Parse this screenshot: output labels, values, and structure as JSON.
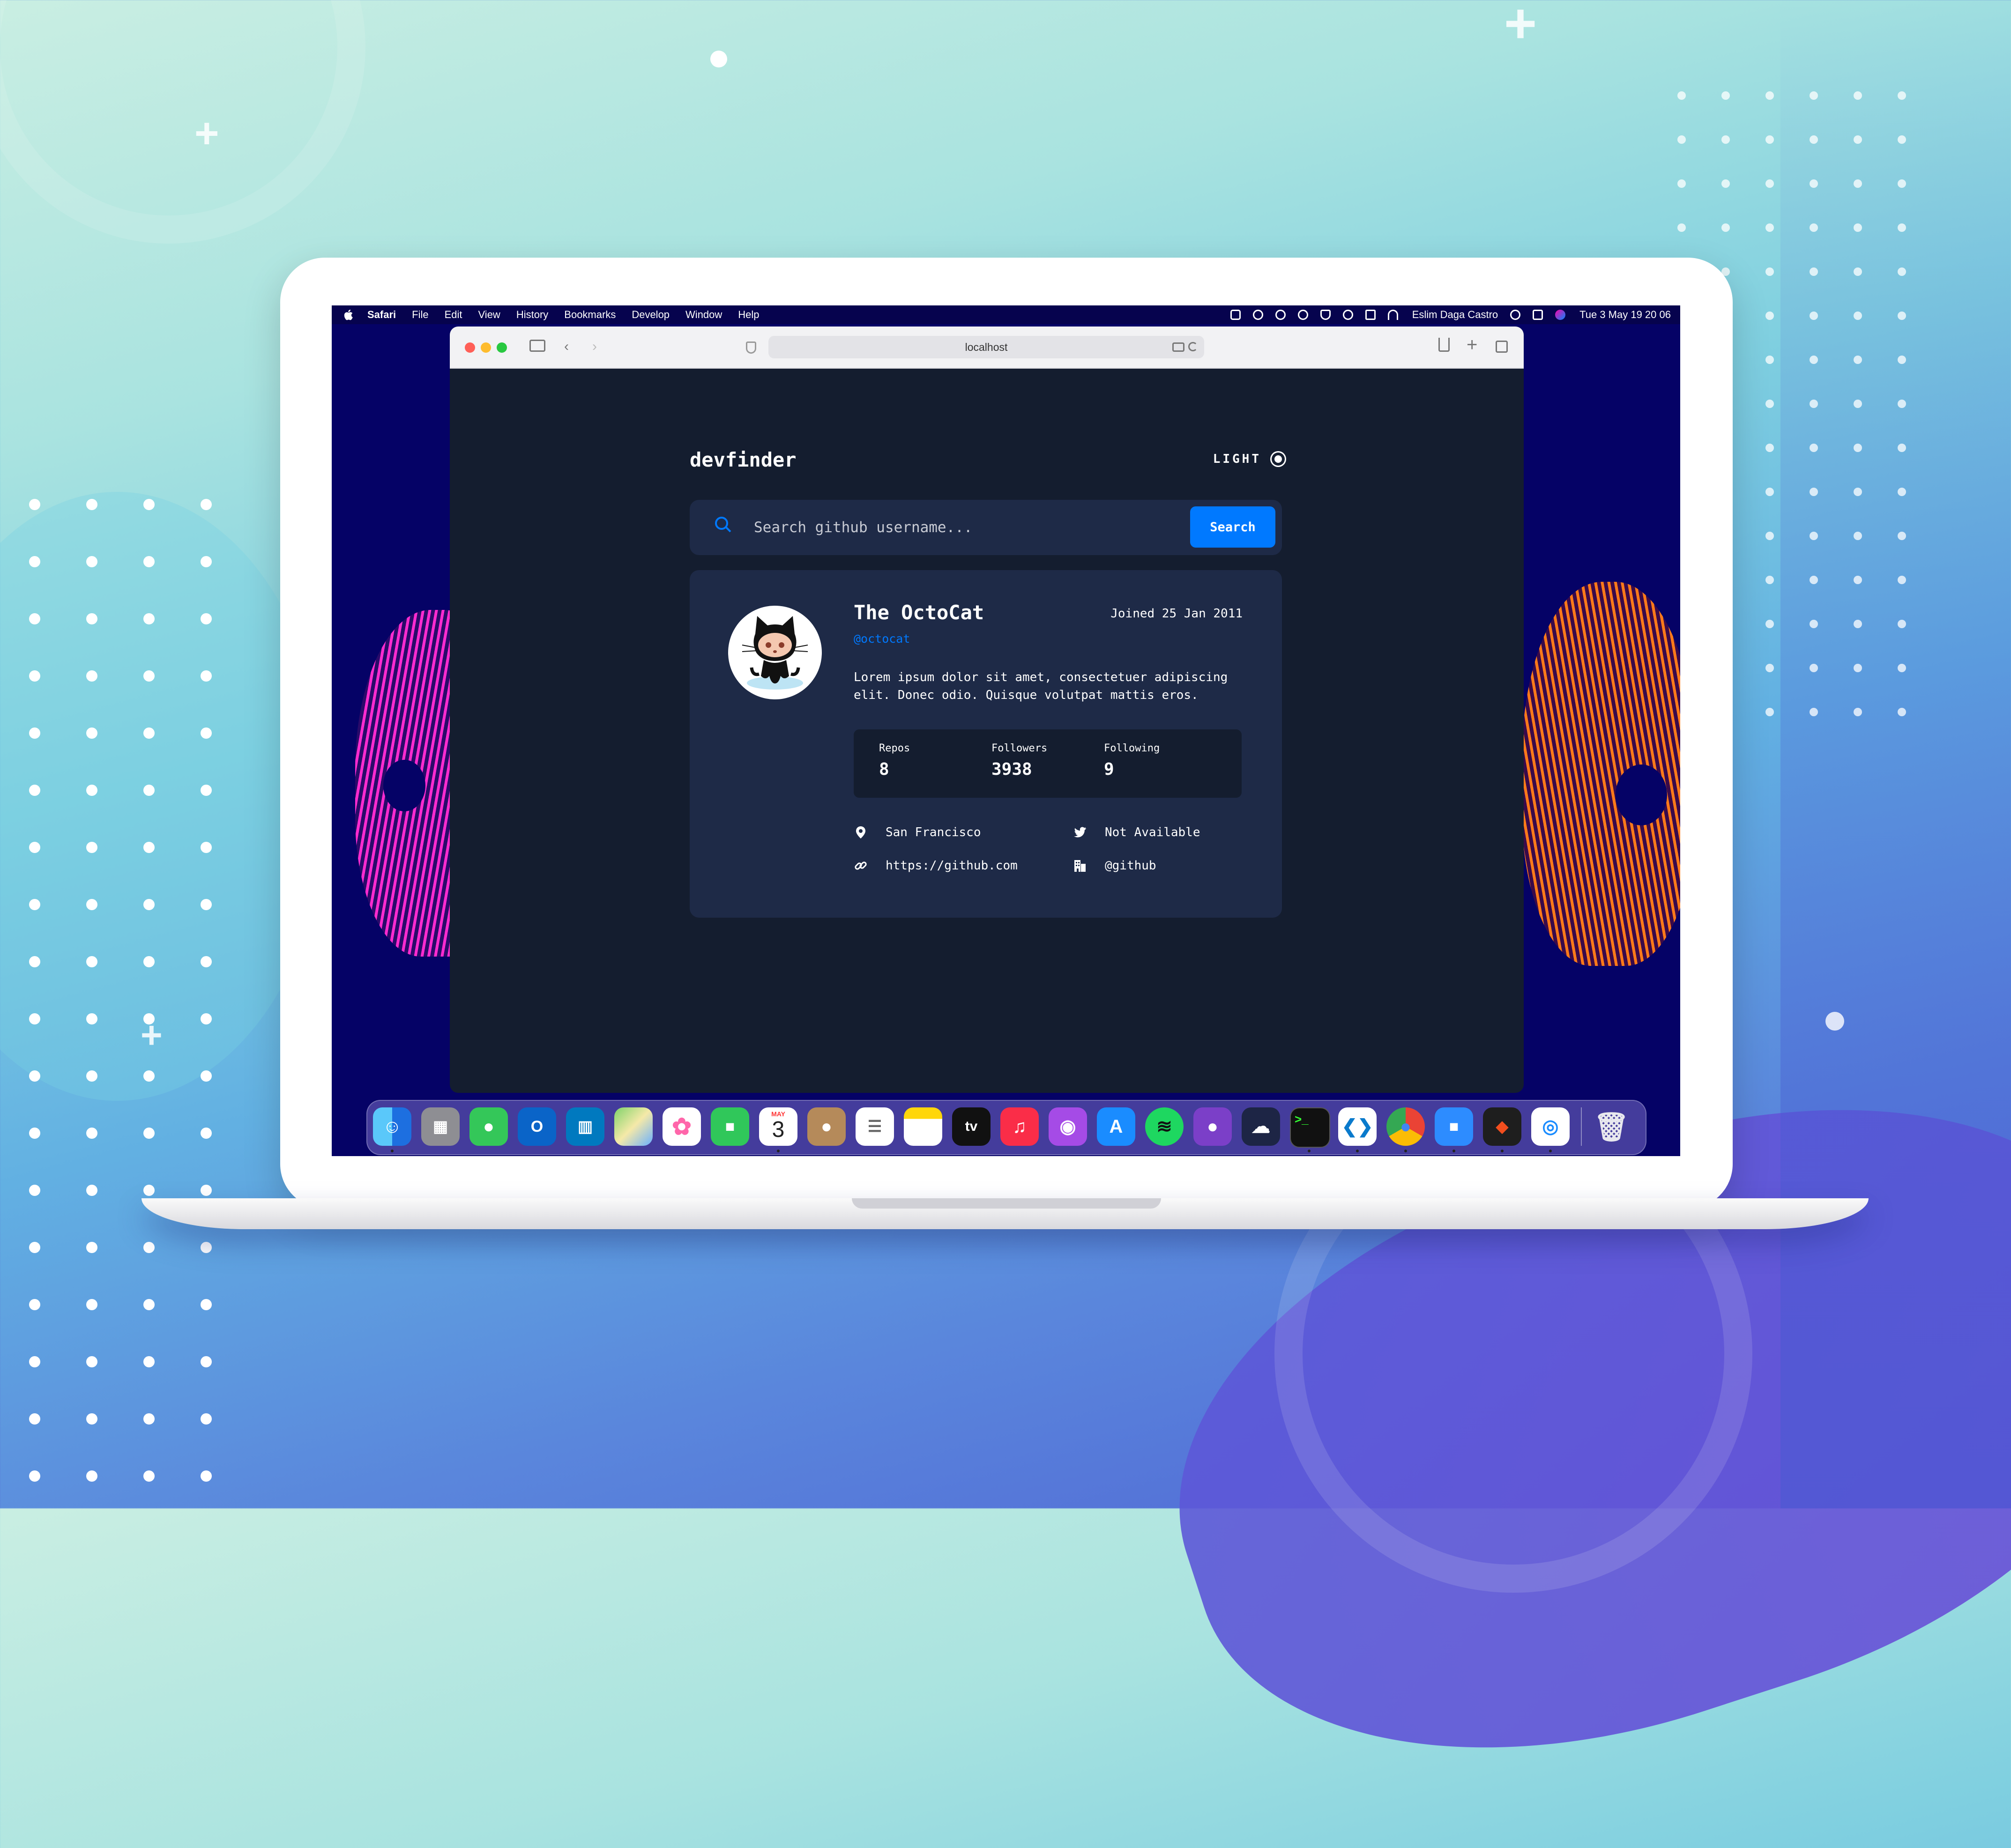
{
  "menubar": {
    "app": "Safari",
    "items": [
      "File",
      "Edit",
      "View",
      "History",
      "Bookmarks",
      "Develop",
      "Window",
      "Help"
    ],
    "user": "Eslim Daga Castro",
    "datetime": "Tue 3 May  19 20 06"
  },
  "browser": {
    "url": "localhost"
  },
  "app": {
    "brand": "devfinder",
    "theme_toggle": "LIGHT",
    "search_placeholder": "Search github username...",
    "search_button": "Search",
    "profile": {
      "name": "The OctoCat",
      "joined": "Joined 25 Jan 2011",
      "handle": "@octocat",
      "bio": "Lorem ipsum dolor sit amet, consectetuer adipiscing elit. Donec odio. Quisque volutpat mattis eros.",
      "stats": {
        "repos_label": "Repos",
        "repos": "8",
        "followers_label": "Followers",
        "followers": "3938",
        "following_label": "Following",
        "following": "9"
      },
      "location": "San Francisco",
      "twitter": "Not Available",
      "website": "https://github.com",
      "company": "@github"
    }
  },
  "dock": {
    "apps": [
      "finder",
      "launchpad",
      "messages",
      "outlook",
      "trello",
      "maps",
      "photos",
      "facetime",
      "calendar",
      "contacts",
      "reminders",
      "notes",
      "tv",
      "music",
      "podcasts",
      "app-store",
      "spotify",
      "github-desktop",
      "cloudapp",
      "terminal",
      "vscode",
      "chrome",
      "zoom",
      "figma",
      "safari",
      "trash"
    ],
    "calendar_month": "MAY",
    "calendar_day": "3",
    "tv_label": "tv"
  },
  "colors": {
    "accent": "#0079ff",
    "app_bg": "#141d2f",
    "card_bg": "#1e2a47"
  }
}
